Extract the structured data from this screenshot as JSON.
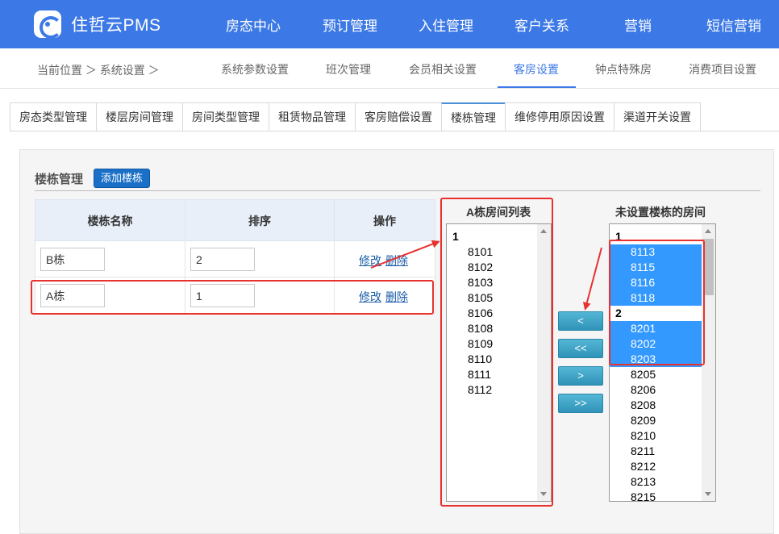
{
  "app": {
    "logo_text": "住哲云PMS"
  },
  "topnav": {
    "items": [
      "房态中心",
      "预订管理",
      "入住管理",
      "客户关系",
      "营销",
      "短信营销"
    ]
  },
  "subnav": {
    "breadcrumb": "当前位置 ＞ 系统设置 ＞",
    "items": [
      "系统参数设置",
      "班次管理",
      "会员相关设置",
      "客房设置",
      "钟点特殊房",
      "消费项目设置"
    ],
    "active": "客房设置"
  },
  "tabs": {
    "items": [
      "房态类型管理",
      "楼层房间管理",
      "房间类型管理",
      "租赁物品管理",
      "客房赔偿设置",
      "楼栋管理",
      "维修停用原因设置",
      "渠道开关设置"
    ],
    "active": "楼栋管理"
  },
  "panel": {
    "title": "楼栋管理",
    "add_button": "添加楼栋"
  },
  "table": {
    "headers": [
      "楼栋名称",
      "排序",
      "操作"
    ],
    "rows": [
      {
        "name": "B栋",
        "order": "2",
        "edit": "修改",
        "delete": "删除"
      },
      {
        "name": "A栋",
        "order": "1",
        "edit": "修改",
        "delete": "删除"
      }
    ]
  },
  "left_list": {
    "title": "A栋房间列表",
    "group": "1",
    "items": [
      "8101",
      "8102",
      "8103",
      "8105",
      "8106",
      "8108",
      "8109",
      "8110",
      "8111",
      "8112"
    ]
  },
  "right_list": {
    "title": "未设置楼栋的房间",
    "group1": "1",
    "group1_items": [
      "8113",
      "8115",
      "8116",
      "8118"
    ],
    "group2": "2",
    "group2_items": [
      "8201",
      "8202",
      "8203",
      "8205",
      "8206",
      "8208",
      "8209",
      "8210",
      "8211",
      "8212",
      "8213",
      "8215"
    ],
    "selected": [
      "8113",
      "8115",
      "8116",
      "8118",
      "8201",
      "8202",
      "8203"
    ]
  },
  "move_buttons": {
    "move_left": "<",
    "move_all_left": "<<",
    "move_right": ">",
    "move_all_right": ">>"
  },
  "colors": {
    "nav_bg": "#3c79e6",
    "accent": "#3c79e6",
    "selection": "#3399ff",
    "annotation": "#e8312f"
  }
}
